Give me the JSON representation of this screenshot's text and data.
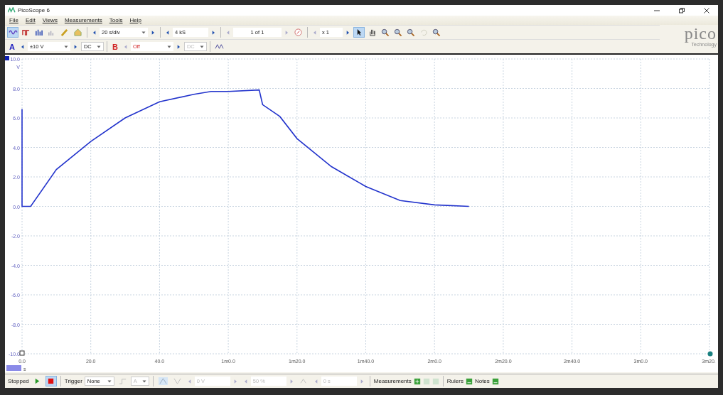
{
  "window": {
    "title": "PicoScope 6"
  },
  "menu": [
    "File",
    "Edit",
    "Views",
    "Measurements",
    "Tools",
    "Help"
  ],
  "mode_buttons": [
    {
      "kind": "scope",
      "selected": true
    },
    {
      "kind": "persistence",
      "selected": false
    },
    {
      "kind": "spectrum",
      "selected": false
    },
    {
      "kind": "serial",
      "selected": false
    }
  ],
  "timebase": "20 s/div",
  "samples": "4 kS",
  "buffer": "1 of 1",
  "zoom": "x 1",
  "tools": [
    {
      "kind": "pointer",
      "selected": true
    },
    {
      "kind": "hand",
      "selected": false
    },
    {
      "kind": "zoom-area",
      "selected": false
    },
    {
      "kind": "zoom-in",
      "selected": false
    },
    {
      "kind": "zoom-out",
      "selected": false
    },
    {
      "kind": "undo",
      "selected": false
    },
    {
      "kind": "zoom-fit",
      "selected": false
    }
  ],
  "channels": [
    {
      "name": "A",
      "range": "±10 V",
      "coupling": "DC",
      "disabled": false,
      "color": "#2020c0"
    },
    {
      "name": "B",
      "range": "Off",
      "coupling": "DC",
      "disabled": true,
      "color": "#d02020"
    }
  ],
  "logo": {
    "text": "pico",
    "subtitle": "Technology"
  },
  "plot": {
    "y_unit": "V",
    "x_unit": "s",
    "chart_data": {
      "type": "line",
      "x": [
        0,
        0,
        2.5,
        10,
        20,
        30,
        40,
        50,
        55,
        60,
        69,
        70,
        75,
        80,
        90,
        100,
        110,
        120,
        130
      ],
      "grid": true,
      "series": [
        {
          "color": "#2233cc",
          "values": [
            6.6,
            0,
            0,
            2.5,
            4.4,
            6.0,
            7.1,
            7.6,
            7.8,
            7.8,
            7.9,
            6.9,
            6.1,
            4.6,
            2.7,
            1.35,
            0.4,
            0.1,
            0.0
          ]
        }
      ],
      "xlim": [
        0,
        200
      ],
      "ylim": [
        -10,
        10
      ],
      "xticks": [
        {
          "value": 0,
          "label": "0.0"
        },
        {
          "value": 20,
          "label": "20.0"
        },
        {
          "value": 40,
          "label": "40.0"
        },
        {
          "value": 60,
          "label": "1m0.0"
        },
        {
          "value": 80,
          "label": "1m20.0"
        },
        {
          "value": 100,
          "label": "1m40.0"
        },
        {
          "value": 120,
          "label": "2m0.0"
        },
        {
          "value": 140,
          "label": "2m20.0"
        },
        {
          "value": 160,
          "label": "2m40.0"
        },
        {
          "value": 180,
          "label": "3m0.0"
        },
        {
          "value": 200,
          "label": "3m20."
        }
      ],
      "yticks": [
        {
          "value": 10,
          "label": "10.0"
        },
        {
          "value": 8,
          "label": "8.0"
        },
        {
          "value": 6,
          "label": "6.0"
        },
        {
          "value": 4,
          "label": "4.0"
        },
        {
          "value": 2,
          "label": "2.0"
        },
        {
          "value": 0,
          "label": "0.0"
        },
        {
          "value": -2,
          "label": "-2.0"
        },
        {
          "value": -4,
          "label": "-4.0"
        },
        {
          "value": -6,
          "label": "-6.0"
        },
        {
          "value": -8,
          "label": "-8.0"
        },
        {
          "value": -10,
          "label": "-10.0"
        }
      ]
    }
  },
  "status": {
    "state": "Stopped",
    "stopped": true,
    "trigger_label": "Trigger",
    "trigger": "None",
    "trigger_channel": "A",
    "threshold": "0 V",
    "pretrigger": "50 %",
    "delay": "0 s",
    "measurements": "Measurements",
    "rulers": "Rulers",
    "notes": "Notes"
  }
}
